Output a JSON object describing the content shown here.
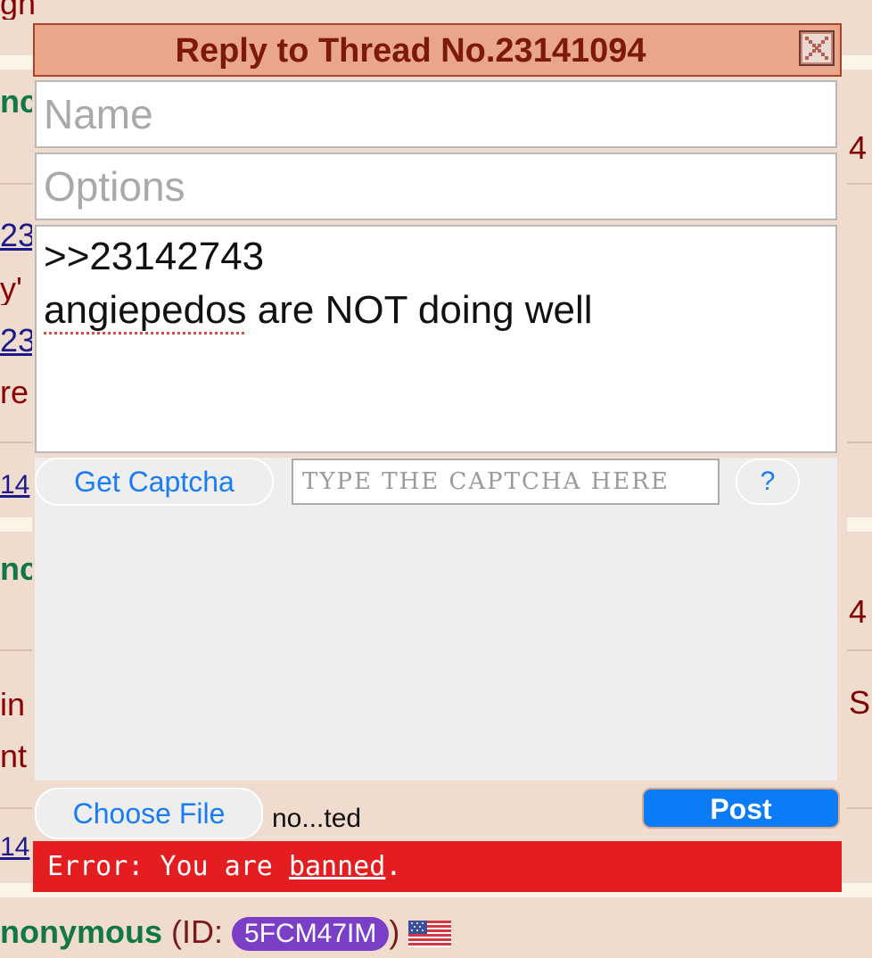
{
  "background": {
    "top_fragment": "gh",
    "left_fragments": [
      "nc",
      "23",
      "y'",
      "23",
      "re",
      "14",
      "nc",
      "in",
      "nt",
      "14"
    ],
    "right_fragments": [
      "4",
      "4",
      "S"
    ]
  },
  "quick_reply": {
    "title": "Reply to Thread No.23141094",
    "name_placeholder": "Name",
    "options_placeholder": "Options",
    "comment_lines": [
      ">>23142743",
      "angiepedos",
      " are NOT doing well"
    ],
    "get_captcha_label": "Get Captcha",
    "captcha_placeholder": "TYPE THE CAPTCHA HERE",
    "captcha_help_label": "?",
    "choose_file_label": "Choose File",
    "file_status": "no...ted",
    "post_label": "Post",
    "error_prefix": "Error: You are ",
    "error_link": "banned",
    "error_suffix": "."
  },
  "bottom_post": {
    "name": "nonymous",
    "id_open": " (ID: ",
    "id": "5FCM47IM",
    "id_close": ")",
    "flag_icon": "us-flag-icon"
  },
  "colors": {
    "page_bg": "#efdccf",
    "header_bg": "#eaa68b",
    "header_text": "#7d1a06",
    "post_button": "#0b7cf5",
    "error_bg": "#e41e20",
    "name_green": "#117743",
    "id_badge": "#7b3fc7"
  }
}
